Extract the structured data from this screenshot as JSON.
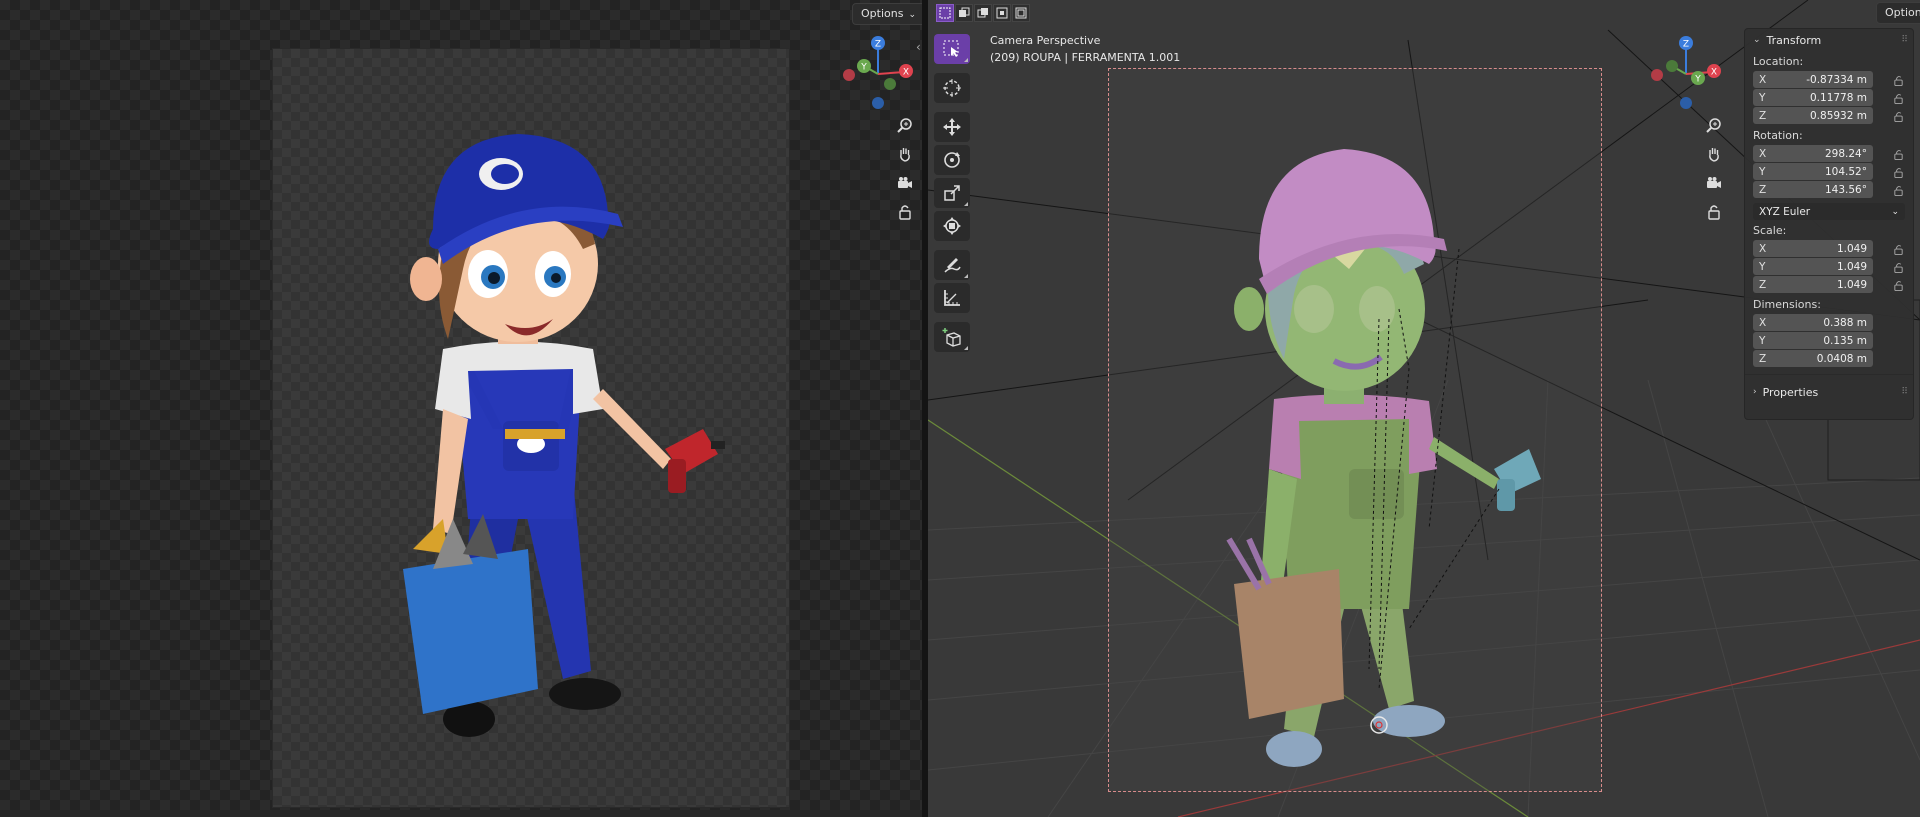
{
  "left_editor": {
    "options_label": "Options"
  },
  "viewport": {
    "options_label": "Options",
    "camera_title": "Camera Perspective",
    "camera_subtitle": "(209) ROUPA | FERRAMENTA 1.001"
  },
  "gizmo_labels": {
    "x": "X",
    "y": "Y",
    "z": "Z"
  },
  "colors": {
    "accent": "#6b3fa8",
    "axis_x": "#e0434f",
    "axis_y": "#6aa84f",
    "axis_z": "#3b7ddd"
  },
  "npanel": {
    "transform_header": "Transform",
    "location_label": "Location:",
    "location": [
      {
        "axis": "X",
        "value": "-0.87334 m"
      },
      {
        "axis": "Y",
        "value": "0.11778 m"
      },
      {
        "axis": "Z",
        "value": "0.85932 m"
      }
    ],
    "rotation_label": "Rotation:",
    "rotation": [
      {
        "axis": "X",
        "value": "298.24°"
      },
      {
        "axis": "Y",
        "value": "104.52°"
      },
      {
        "axis": "Z",
        "value": "143.56°"
      }
    ],
    "rotation_mode": "XYZ Euler",
    "scale_label": "Scale:",
    "scale": [
      {
        "axis": "X",
        "value": "1.049"
      },
      {
        "axis": "Y",
        "value": "1.049"
      },
      {
        "axis": "Z",
        "value": "1.049"
      }
    ],
    "dimensions_label": "Dimensions:",
    "dimensions": [
      {
        "axis": "X",
        "value": "0.388 m"
      },
      {
        "axis": "Y",
        "value": "0.135 m"
      },
      {
        "axis": "Z",
        "value": "0.0408 m"
      }
    ],
    "properties_header": "Properties"
  },
  "toolbar_icons": [
    "select-box-icon",
    "cursor-icon",
    "move-icon",
    "rotate-icon",
    "scale-icon",
    "transform-icon",
    "annotate-icon",
    "measure-icon",
    "add-cube-icon"
  ]
}
